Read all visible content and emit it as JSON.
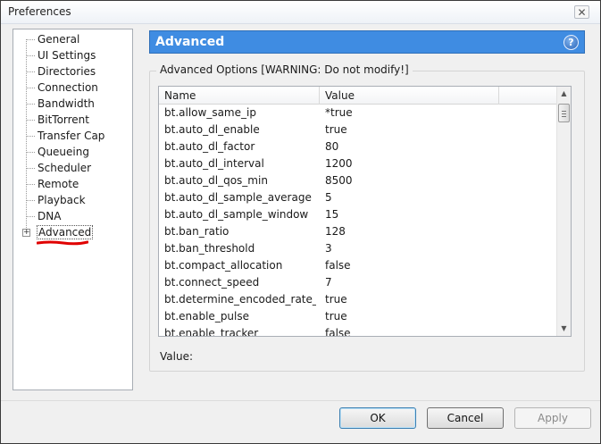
{
  "window": {
    "title": "Preferences",
    "close_glyph": "✕"
  },
  "sidebar": {
    "items": [
      {
        "label": "General"
      },
      {
        "label": "UI Settings"
      },
      {
        "label": "Directories"
      },
      {
        "label": "Connection"
      },
      {
        "label": "Bandwidth"
      },
      {
        "label": "BitTorrent"
      },
      {
        "label": "Transfer Cap"
      },
      {
        "label": "Queueing"
      },
      {
        "label": "Scheduler"
      },
      {
        "label": "Remote"
      },
      {
        "label": "Playback"
      },
      {
        "label": "DNA"
      },
      {
        "label": "Advanced",
        "selected": true,
        "expandable": true
      }
    ],
    "expander_glyph": "+",
    "annotation_color": "#e00000"
  },
  "panel": {
    "title": "Advanced",
    "help_glyph": "?",
    "header_color": "#3f8ce2",
    "group_label": "Advanced Options [WARNING: Do not modify!]",
    "columns": {
      "name": "Name",
      "value": "Value"
    },
    "rows": [
      {
        "name": "bt.allow_same_ip",
        "value": "*true"
      },
      {
        "name": "bt.auto_dl_enable",
        "value": "true"
      },
      {
        "name": "bt.auto_dl_factor",
        "value": "80"
      },
      {
        "name": "bt.auto_dl_interval",
        "value": "1200"
      },
      {
        "name": "bt.auto_dl_qos_min",
        "value": "8500"
      },
      {
        "name": "bt.auto_dl_sample_average",
        "value": "5"
      },
      {
        "name": "bt.auto_dl_sample_window",
        "value": "15"
      },
      {
        "name": "bt.ban_ratio",
        "value": "128"
      },
      {
        "name": "bt.ban_threshold",
        "value": "3"
      },
      {
        "name": "bt.compact_allocation",
        "value": "false"
      },
      {
        "name": "bt.connect_speed",
        "value": "7"
      },
      {
        "name": "bt.determine_encoded_rate_fo...",
        "value": "true"
      },
      {
        "name": "bt.enable_pulse",
        "value": "true"
      },
      {
        "name": "bt.enable_tracker",
        "value": "false"
      }
    ],
    "value_label": "Value:"
  },
  "buttons": {
    "ok": "OK",
    "cancel": "Cancel",
    "apply": "Apply"
  },
  "icons": {
    "scroll_up": "▲",
    "scroll_down": "▼"
  }
}
